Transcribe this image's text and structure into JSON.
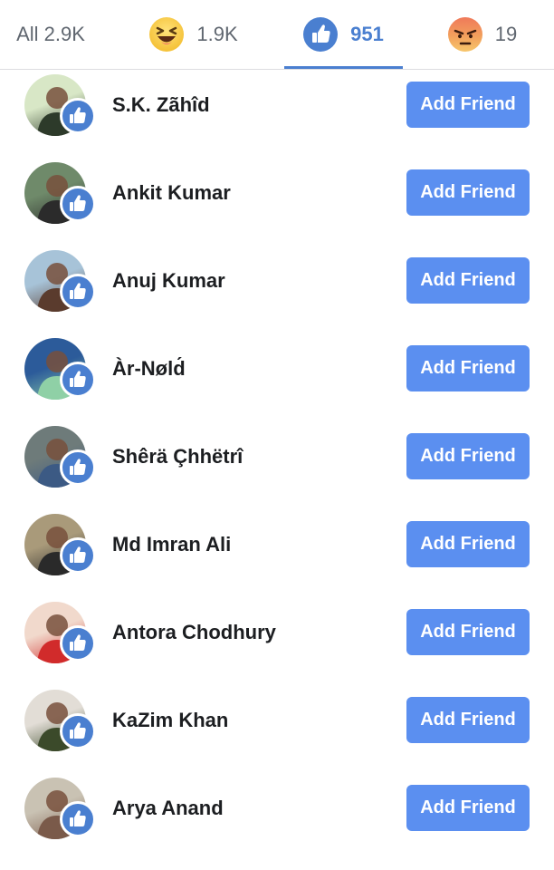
{
  "tabs": {
    "all": {
      "label": "All",
      "count": "2.9K"
    },
    "haha": {
      "count": "1.9K",
      "icon": "haha-reaction-icon"
    },
    "like": {
      "count": "951",
      "icon": "like-reaction-icon"
    },
    "angry": {
      "count": "19",
      "icon": "angry-reaction-icon"
    }
  },
  "colors": {
    "accent": "#4a7fd0",
    "button": "#5b8ff0",
    "text": "#1c1e21",
    "muted": "#606770"
  },
  "people": [
    {
      "name": "S.K. Zãhîd",
      "button": "Add Friend",
      "avatar_colors": [
        "#d8e7c6",
        "#2d3a2a"
      ]
    },
    {
      "name": "Ankit Kumar",
      "button": "Add Friend",
      "avatar_colors": [
        "#6f8a6a",
        "#2b2b2b"
      ]
    },
    {
      "name": "Anuj Kumar",
      "button": "Add Friend",
      "avatar_colors": [
        "#a7c3d8",
        "#5a3b2d"
      ]
    },
    {
      "name": "Àr-Nøld́",
      "button": "Add Friend",
      "avatar_colors": [
        "#2c5b9a",
        "#8fd0a6"
      ]
    },
    {
      "name": "Shêrä Çhhëtrî",
      "button": "Add Friend",
      "avatar_colors": [
        "#6e7b7a",
        "#3c5a84"
      ]
    },
    {
      "name": "Md Imran Ali",
      "button": "Add Friend",
      "avatar_colors": [
        "#a99a7a",
        "#2a2a2a"
      ]
    },
    {
      "name": "Antora Chodhury",
      "button": "Add Friend",
      "avatar_colors": [
        "#f1d9cc",
        "#d12b2b"
      ]
    },
    {
      "name": "KaZim Khan",
      "button": "Add Friend",
      "avatar_colors": [
        "#e2ddd6",
        "#3b4a2a"
      ]
    },
    {
      "name": "Arya Anand",
      "button": "Add Friend",
      "avatar_colors": [
        "#c9c2b3",
        "#7a5a4a"
      ]
    }
  ]
}
